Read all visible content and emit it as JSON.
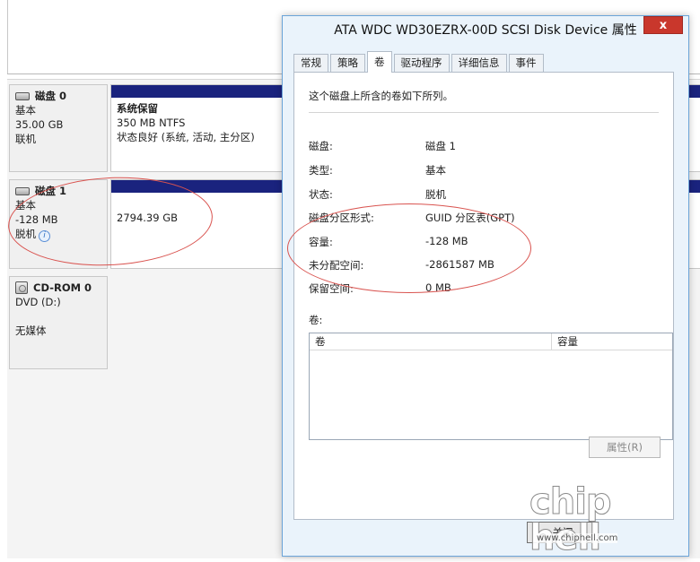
{
  "disks": [
    {
      "name": "磁盘 0",
      "type": "基本",
      "size": "35.00 GB",
      "status": "联机",
      "volume": {
        "name": "系统保留",
        "detail": "350 MB NTFS",
        "health": "状态良好 (系统, 活动, 主分区)"
      }
    },
    {
      "name": "磁盘 1",
      "type": "基本",
      "size": "-128 MB",
      "status": "脱机",
      "volume": {
        "detail": "2794.39 GB"
      }
    },
    {
      "name": "CD-ROM 0",
      "type": "DVD (D:)",
      "status": "无媒体"
    }
  ],
  "dialog": {
    "title": "ATA WDC WD30EZRX-00D SCSI Disk Device 属性",
    "close": "x",
    "tabs": [
      "常规",
      "策略",
      "卷",
      "驱动程序",
      "详细信息",
      "事件"
    ],
    "active_tab": "卷",
    "intro": "这个磁盘上所含的卷如下所列。",
    "properties": [
      {
        "key": "磁盘:",
        "value": "磁盘 1"
      },
      {
        "key": "类型:",
        "value": "基本"
      },
      {
        "key": "状态:",
        "value": "脱机"
      },
      {
        "key": "磁盘分区形式:",
        "value": "GUID 分区表(GPT)"
      },
      {
        "key": "容量:",
        "value": "-128 MB"
      },
      {
        "key": "未分配空间:",
        "value": "-2861587 MB"
      },
      {
        "key": "保留空间:",
        "value": "0 MB"
      }
    ],
    "volumes_label": "卷:",
    "volumes_columns": [
      "卷",
      "容量"
    ],
    "properties_button": "属性(R)",
    "ok_button": "关闭"
  },
  "watermark": {
    "logo": "chip hell",
    "url": "www.chiphell.com"
  },
  "colors": {
    "volume_bar": "#1a237e",
    "annotation": "#d9534f",
    "close_button": "#c9372c"
  }
}
